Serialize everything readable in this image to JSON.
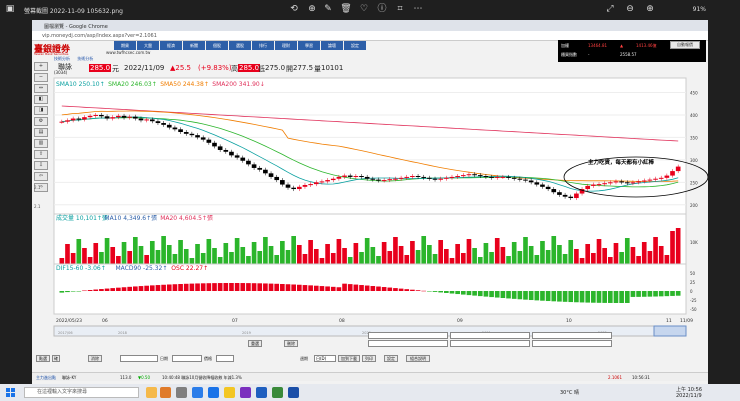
{
  "viewer": {
    "title": "螢幕截圖 2022-11-09 105632.png",
    "zoom": "91%"
  },
  "browser": {
    "window_title": "圖檔瀏覽 - Google Chrome",
    "url": "vip.moneydj.com/asp/Index.aspx?ver=2.1061"
  },
  "site": {
    "logo": "臺銀證券",
    "logo_sub": "Taiwan Bank Securities",
    "url_text": "www.twfhcsec.com.tw",
    "nav": [
      "期貨",
      "大盤",
      "經濟",
      "新聞",
      "個股",
      "選股",
      "排行",
      "理財",
      "學習",
      "論壇",
      "設定"
    ],
    "tabs": [
      "技術分析",
      "技術分析"
    ],
    "top_button": "自動報價"
  },
  "realtime": {
    "row1_label": "加權",
    "row1_val1": "13464.81",
    "row1_val2": "▲",
    "row1_val3": "1413.46億",
    "row2_label": "櫃買指數",
    "row2_val1": "-",
    "row2_val2": "2558.57"
  },
  "left_tools": [
    "+",
    "−",
    "⇔",
    "◧",
    "◨",
    "⚙",
    "▤",
    "▥",
    "⇧",
    "⇩",
    "⇦",
    "⇨"
  ],
  "left_labels": [
    "2.1",
    "2.1"
  ],
  "quote": {
    "name": "聯詠",
    "code": "(3034)",
    "price": "285.0",
    "price_unit": "元",
    "date": "2022/11/09",
    "change": "▲25.5",
    "change_pct": "(+9.83%)",
    "high_label": "高",
    "high": "285.0",
    "low_label": "低",
    "low": "275.0",
    "close_label": "開",
    "close": "277.5",
    "vol_label": "量",
    "vol": "10101"
  },
  "indicators": {
    "ma_line": [
      {
        "text": "SMA10 250.10",
        "color": "#0aa0a0",
        "arrow": "↑"
      },
      {
        "text": "SMA20 246.03",
        "color": "#2bb52b",
        "arrow": "↑"
      },
      {
        "text": "SMA50 244.38",
        "color": "#f07d00",
        "arrow": "↑"
      },
      {
        "text": "SMA200 341.90",
        "color": "#e0305a",
        "arrow": "↓"
      }
    ],
    "vol_line": [
      {
        "text": "成交量 10,101",
        "color": "#0aa0a0",
        "arrow": "↑張"
      },
      {
        "text": "MA10 4,349.6",
        "color": "#2d5fa8",
        "arrow": "↑張"
      },
      {
        "text": "MA20 4,604.5",
        "color": "#e0305a",
        "arrow": "↑張"
      }
    ],
    "macd_line": [
      {
        "text": "DIF15-60 -3.06",
        "color": "#0aa0a0",
        "arrow": "↑"
      },
      {
        "text": "MACD90 -25.32",
        "color": "#2d5fa8",
        "arrow": "↑"
      },
      {
        "text": "OSC 22.27",
        "color": "#e8001c",
        "arrow": "↑"
      }
    ]
  },
  "annotation": "主力吃貨，每天都有小紅棒",
  "price_axis": [
    "450",
    "400",
    "350",
    "300",
    "250",
    "200"
  ],
  "vol_axis": [
    "10K"
  ],
  "macd_axis": [
    "50",
    "25",
    "0",
    "-25",
    "-50"
  ],
  "time_axis": [
    "2022/05/23",
    "06",
    "07",
    "08",
    "09",
    "10",
    "11",
    "11/09"
  ],
  "navigator_labels": [
    "2017/06",
    "2018",
    "2019",
    "2020",
    "2021",
    "2022"
  ],
  "bottom": {
    "btn_new": "重選",
    "btn_del": "刪除",
    "btn_stock": "點選",
    "btn_ok": "確",
    "btn_clear": "消除",
    "label_date": "日期",
    "label_price": "價格",
    "label_cycle": "週期",
    "select_cycle": "日(D)",
    "btn_add": "加到下載",
    "btn_print": "列印",
    "btn_setting": "設定",
    "btn_more": "組合說明"
  },
  "status": {
    "left": "主力進出點",
    "mid1": "聯詠-KY",
    "mid2": "113.0",
    "mid3": "▼0.50",
    "news": "10:40:48 聯詠10月營收降幅收斂 年減1.3%",
    "right1": "2.1061",
    "right2": "10:56:31"
  },
  "taskbar": {
    "search": "在這裡輸入文字來搜尋",
    "temp": "30°C 晴",
    "time": "上午 10:56",
    "date": "2022/11/9"
  },
  "chart_data": {
    "type": "candlestick",
    "title": "",
    "ylim": [
      175,
      460
    ],
    "x_ticks": [
      "2022/05/23",
      "06",
      "07",
      "08",
      "09",
      "10",
      "11",
      "11/09"
    ],
    "candles_close_approx": [
      385,
      388,
      392,
      390,
      395,
      398,
      400,
      397,
      392,
      395,
      398,
      394,
      396,
      392,
      388,
      390,
      386,
      382,
      378,
      372,
      368,
      362,
      358,
      355,
      350,
      345,
      338,
      330,
      322,
      318,
      310,
      305,
      298,
      290,
      282,
      278,
      270,
      262,
      255,
      245,
      238,
      235,
      240,
      244,
      246,
      250,
      252,
      255,
      258,
      262,
      265,
      262,
      264,
      262,
      258,
      256,
      254,
      255,
      257,
      258,
      260,
      262,
      264,
      262,
      260,
      258,
      256,
      258,
      260,
      262,
      264,
      266,
      268,
      266,
      264,
      262,
      260,
      262,
      262,
      260,
      258,
      256,
      254,
      250,
      245,
      240,
      235,
      228,
      222,
      218,
      215,
      225,
      235,
      242,
      245,
      246,
      248,
      250,
      252,
      250,
      248,
      250,
      252,
      254,
      256,
      258,
      260,
      265,
      275,
      285
    ],
    "sma200_start": 420,
    "sma200_end": 341.9,
    "volume_max_label": "10K",
    "macd_range": [
      -50,
      50
    ]
  }
}
